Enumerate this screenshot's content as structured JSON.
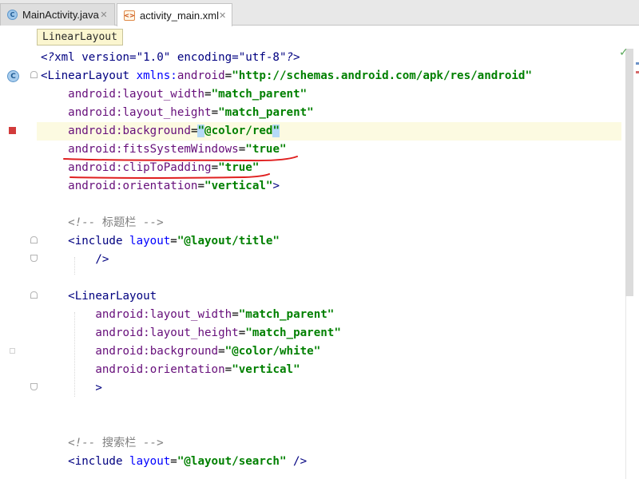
{
  "tabs": [
    {
      "label": "MainActivity.java",
      "icon": "java-class-icon",
      "active": false
    },
    {
      "label": "activity_main.xml",
      "icon": "xml-file-icon",
      "active": true
    }
  ],
  "breadcrumb": "LinearLayout",
  "gutter_marks": {
    "class_glyph": "C"
  },
  "code": {
    "l1": {
      "a": "<?",
      "b": "xml version=\"1.0\" encoding=\"utf-8\"",
      "c": "?>"
    },
    "l2": {
      "open": "<LinearLayout ",
      "ns": "xmlns:",
      "attr": "android",
      "eq": "=",
      "val": "\"http://schemas.android.com/apk/res/android\""
    },
    "l3": {
      "ns": "android:",
      "attr": "layout_width",
      "eq": "=",
      "val": "\"match_parent\""
    },
    "l4": {
      "ns": "android:",
      "attr": "layout_height",
      "eq": "=",
      "val": "\"match_parent\""
    },
    "l5": {
      "ns": "android:",
      "attr": "background",
      "eq": "=",
      "q1": "\"",
      "val": "@color/red",
      "q2": "\""
    },
    "l6": {
      "ns": "android:",
      "attr": "fitsSystemWindows",
      "eq": "=",
      "val": "\"true\""
    },
    "l7": {
      "ns": "android:",
      "attr": "clipToPadding",
      "eq": "=",
      "val": "\"true\""
    },
    "l8": {
      "ns": "android:",
      "attr": "orientation",
      "eq": "=",
      "val": "\"vertical\"",
      "close": ">"
    },
    "l10": {
      "open": "<!-- ",
      "text": "标题栏",
      "close": " -->"
    },
    "l11": {
      "open": "<include ",
      "attr": "layout",
      "eq": "=",
      "val": "\"@layout/title\""
    },
    "l12": {
      "close": "/>"
    },
    "l14": {
      "open": "<LinearLayout"
    },
    "l15": {
      "ns": "android:",
      "attr": "layout_width",
      "eq": "=",
      "val": "\"match_parent\""
    },
    "l16": {
      "ns": "android:",
      "attr": "layout_height",
      "eq": "=",
      "val": "\"match_parent\""
    },
    "l17": {
      "ns": "android:",
      "attr": "background",
      "eq": "=",
      "val": "\"@color/white\""
    },
    "l18": {
      "ns": "android:",
      "attr": "orientation",
      "eq": "=",
      "val": "\"vertical\""
    },
    "l19": {
      "close": ">"
    },
    "l22": {
      "open": "<!-- ",
      "text": "搜索栏",
      "close": " -->"
    },
    "l23": {
      "open": "<include ",
      "attr": "layout",
      "eq": "=",
      "val": "\"@layout/search\"",
      "close": " />"
    }
  },
  "colors": {
    "tag": "#000080",
    "attribute_namespace": "#660e7a",
    "attribute_name": "#0000ff",
    "attribute_value": "#008000",
    "comment": "#808080",
    "current_line": "#fcfae1",
    "annotation_underline": "#e02020",
    "breakpoint_marker": "#d23b3b"
  },
  "annotations": [
    "fitsSystemWindows-underline",
    "clipToPadding-underline"
  ]
}
